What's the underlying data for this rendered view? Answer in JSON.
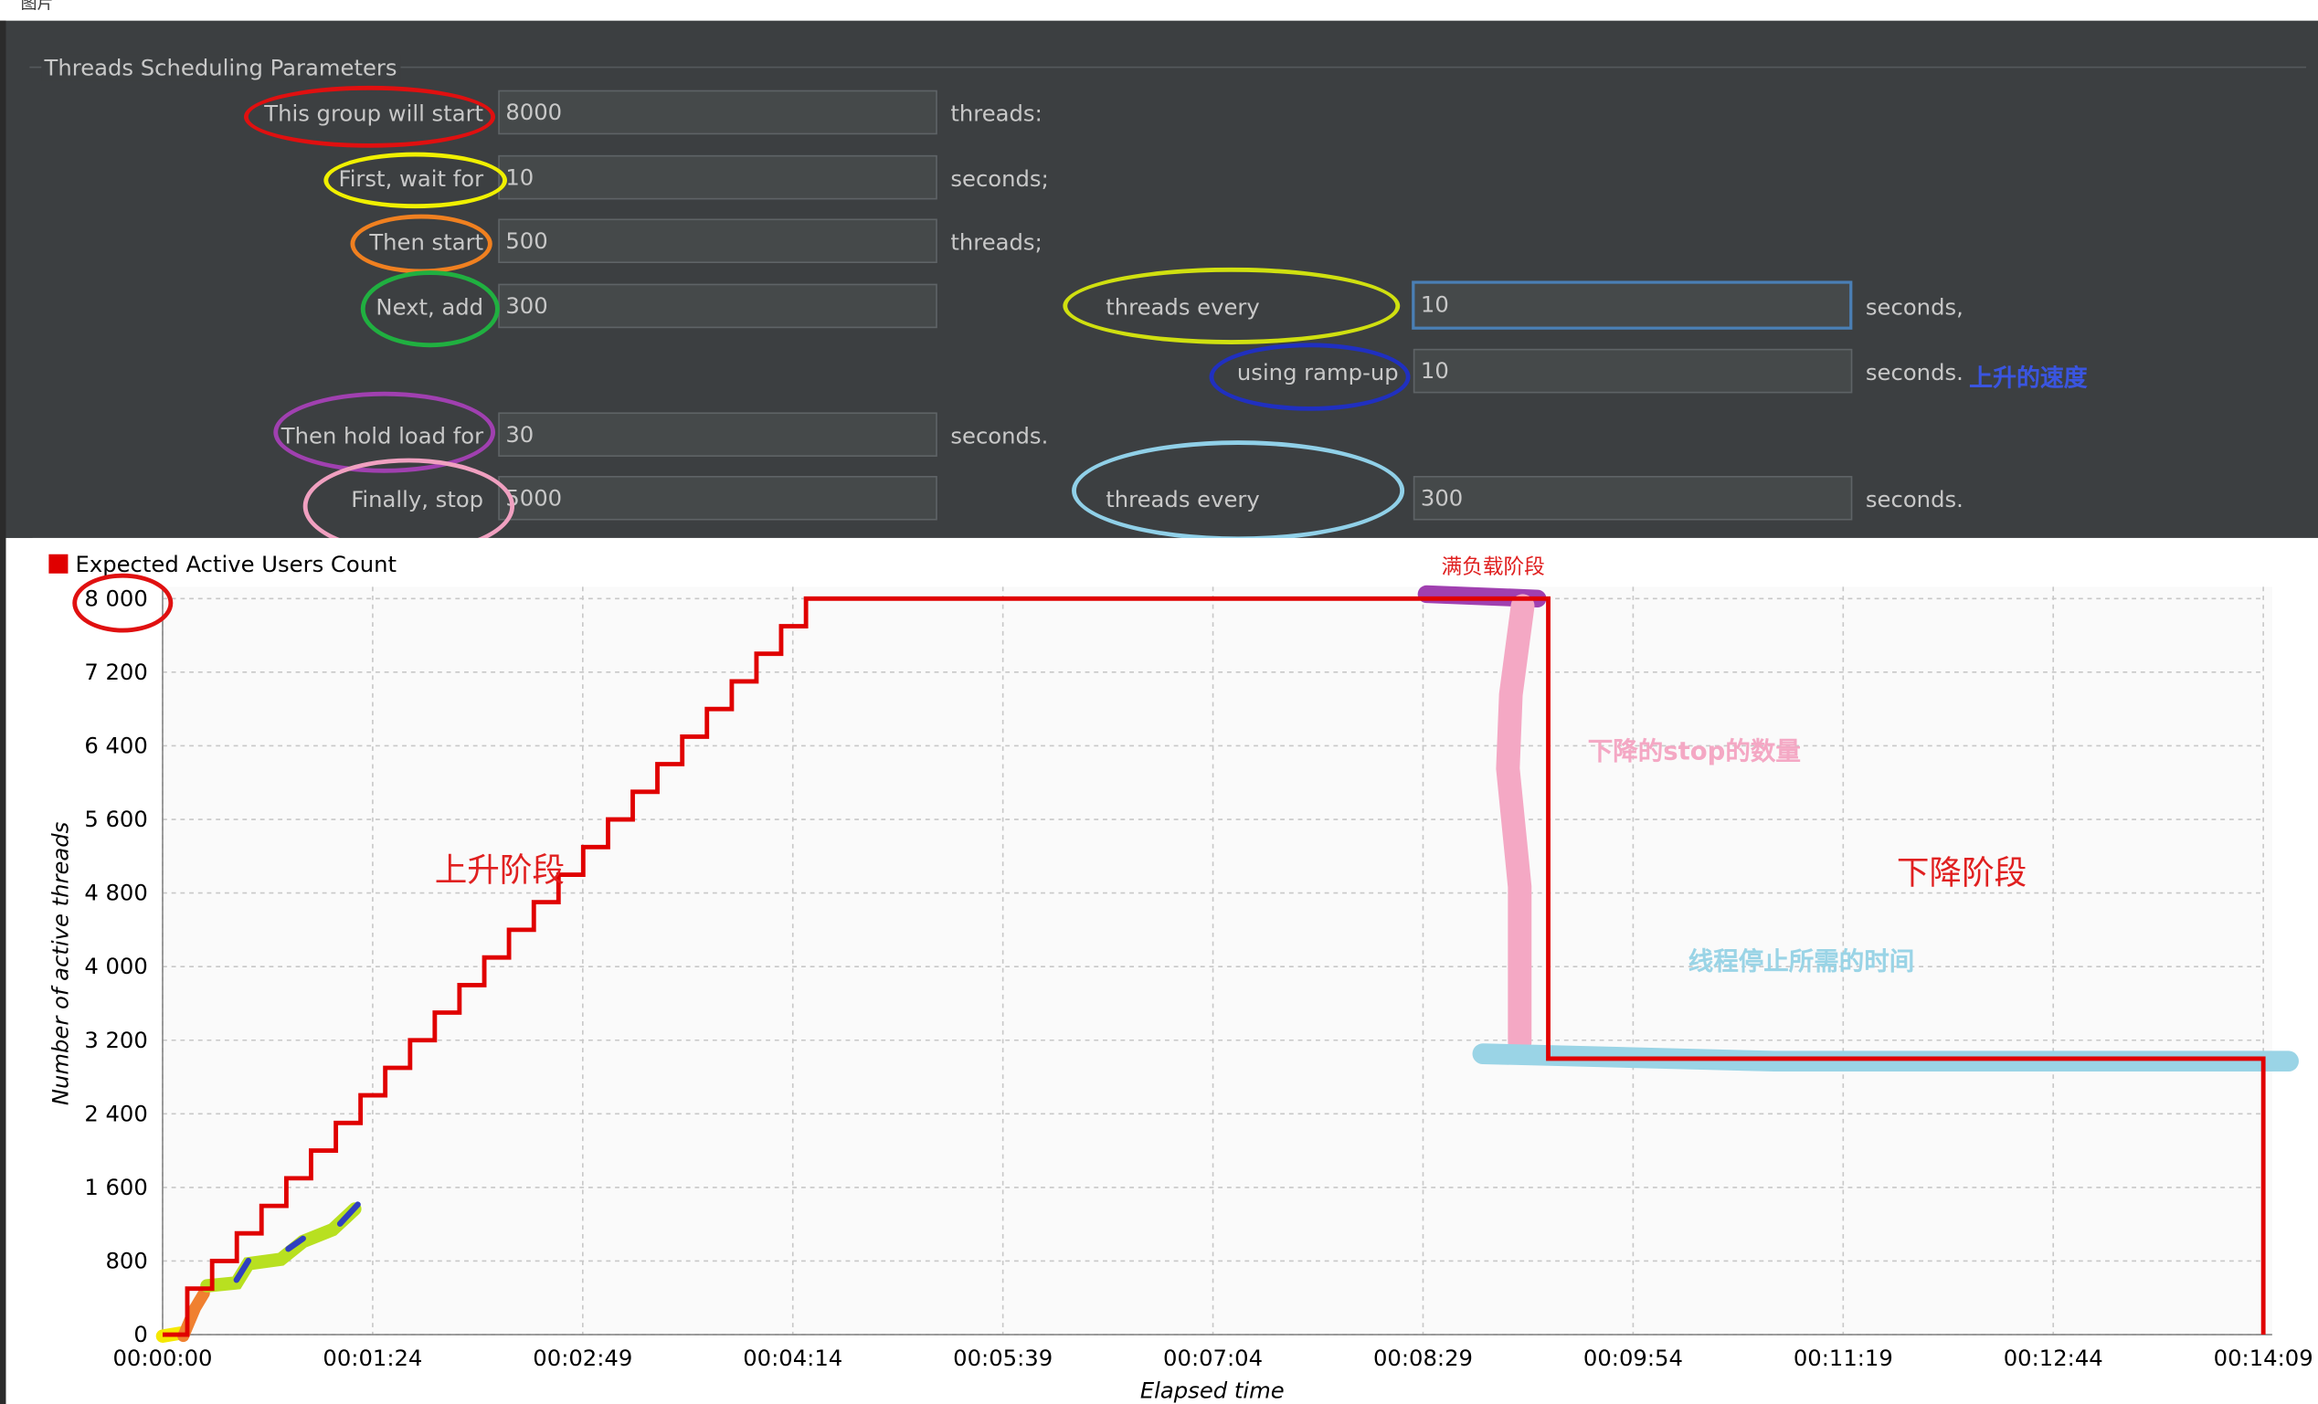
{
  "top_caption": "图片",
  "panel": {
    "title": "Threads Scheduling Parameters",
    "rows": [
      {
        "label": "This group will start",
        "value": "8000",
        "unit": "threads:"
      },
      {
        "label": "First, wait for",
        "value": "10",
        "unit": "seconds;"
      },
      {
        "label": "Then start",
        "value": "500",
        "unit": "threads;"
      },
      {
        "label": "Next, add",
        "value": "300",
        "unit": "",
        "label2": "threads every",
        "value2": "10",
        "unit2": "seconds,"
      },
      {
        "label2": "using ramp-up",
        "value2": "10",
        "unit2": "seconds."
      },
      {
        "label": "Then hold load for",
        "value": "30",
        "unit": "seconds."
      },
      {
        "label": "Finally, stop",
        "value": "5000",
        "label2": "threads every",
        "value2": "300",
        "unit2": "seconds."
      }
    ],
    "ramp_note": "上升的速度"
  },
  "annotations": {
    "full_load": "满负载阶段",
    "stop_count": "下降的stop的数量",
    "rise_phase": "上升阶段",
    "fall_phase": "下降阶段",
    "stop_time": "线程停止所需的时间"
  },
  "colors": {
    "panel_bg": "#3c3f41",
    "line": "#e00000",
    "oval_red": "#e01010",
    "oval_yellow": "#f0f000",
    "oval_orange": "#f08020",
    "oval_green": "#20b040",
    "oval_yellowgreen": "#d0e010",
    "oval_blue": "#2030c0",
    "oval_purple": "#a040b0",
    "oval_pink": "#f0a0c0",
    "oval_lightblue": "#90d0e8"
  },
  "chart_data": {
    "type": "line",
    "title": "",
    "legend": "Expected Active Users Count",
    "xlabel": "Elapsed time",
    "ylabel": "Number of active threads",
    "yticks": [
      "0",
      "800",
      "1 600",
      "2 400",
      "3 200",
      "4 000",
      "4 800",
      "5 600",
      "6 400",
      "7 200",
      "8 000"
    ],
    "ylim": [
      0,
      8000
    ],
    "xticks": [
      "00:00:00",
      "00:01:24",
      "00:02:49",
      "00:04:14",
      "00:05:39",
      "00:07:04",
      "00:08:29",
      "00:09:54",
      "00:11:19",
      "00:12:44",
      "00:14:09"
    ],
    "xlim_seconds": [
      0,
      849
    ],
    "grid": true,
    "legend_position": "top-left",
    "series": [
      {
        "name": "Expected Active Users Count",
        "x_seconds": [
          0,
          10,
          10,
          20,
          20,
          30,
          30,
          40,
          40,
          50,
          50,
          60,
          60,
          70,
          70,
          80,
          80,
          90,
          90,
          100,
          100,
          110,
          110,
          120,
          120,
          130,
          130,
          140,
          140,
          150,
          150,
          160,
          160,
          170,
          170,
          180,
          180,
          190,
          190,
          200,
          200,
          210,
          210,
          220,
          220,
          230,
          230,
          240,
          240,
          250,
          250,
          260,
          260,
          270,
          270,
          280,
          280,
          290,
          290,
          300,
          300,
          310,
          310,
          320,
          320,
          330,
          330,
          340,
          340,
          350,
          350,
          360,
          360,
          370,
          370,
          380,
          380,
          390,
          390,
          400,
          400,
          410,
          410,
          420,
          420,
          430,
          430,
          440,
          440,
          450,
          450,
          460,
          460,
          470,
          470,
          480,
          480,
          490,
          490,
          500,
          500,
          510,
          510,
          520,
          520,
          530,
          530,
          560,
          560,
          849,
          849
        ],
        "y": [
          0,
          0,
          500,
          500,
          800,
          800,
          1100,
          1100,
          1400,
          1400,
          1700,
          1700,
          2000,
          2000,
          2300,
          2300,
          2600,
          2600,
          2900,
          2900,
          3200,
          3200,
          3500,
          3500,
          3800,
          3800,
          4100,
          4100,
          4400,
          4400,
          4700,
          4700,
          5000,
          5000,
          5300,
          5300,
          5600,
          5600,
          5900,
          5900,
          6200,
          6200,
          6500,
          6500,
          6800,
          6800,
          7100,
          7100,
          7400,
          7400,
          7700,
          7700,
          8000,
          8000,
          8000,
          8000,
          8000,
          8000,
          8000,
          8000,
          8000,
          8000,
          8000,
          8000,
          8000,
          8000,
          8000,
          8000,
          8000,
          8000,
          8000,
          8000,
          8000,
          8000,
          8000,
          8000,
          8000,
          8000,
          8000,
          8000,
          8000,
          8000,
          8000,
          8000,
          8000,
          8000,
          8000,
          8000,
          8000,
          8000,
          8000,
          8000,
          8000,
          8000,
          8000,
          8000,
          8000,
          8000,
          8000,
          8000,
          8000,
          8000,
          8000,
          8000,
          8000,
          8000,
          8000,
          8000,
          3000,
          3000,
          0
        ]
      }
    ]
  }
}
